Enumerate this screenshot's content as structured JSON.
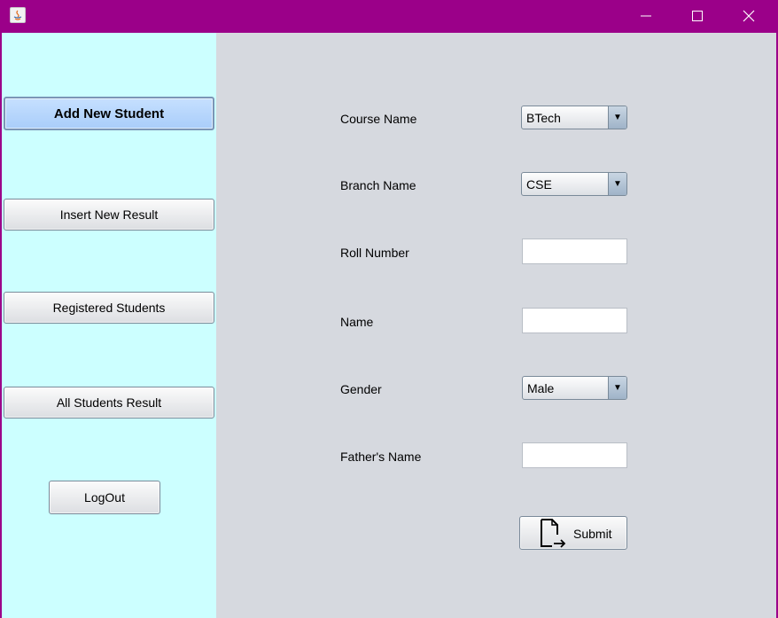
{
  "window": {
    "title": ""
  },
  "sidebar": {
    "add_new_student": "Add New Student",
    "insert_new_result": "Insert New Result",
    "registered_students": "Registered Students",
    "all_students_result": "All Students Result",
    "logout": "LogOut"
  },
  "form": {
    "course_label": "Course Name",
    "course_value": "BTech",
    "branch_label": "Branch Name",
    "branch_value": "CSE",
    "roll_label": "Roll Number",
    "roll_value": "",
    "name_label": "Name",
    "name_value": "",
    "gender_label": "Gender",
    "gender_value": "Male",
    "father_label": "Father's Name",
    "father_value": "",
    "submit_label": "Submit"
  },
  "icons": {
    "app": "java-app-icon",
    "minimize": "minimize-icon",
    "maximize": "maximize-icon",
    "close": "close-icon",
    "submit": "document-export-icon",
    "dropdown": "triangle-down-icon"
  },
  "colors": {
    "titlebar": "#9b0089",
    "sidebar_bg": "#ccffff",
    "main_bg": "#d6d9df",
    "primary_button": "#b8d6fc"
  }
}
